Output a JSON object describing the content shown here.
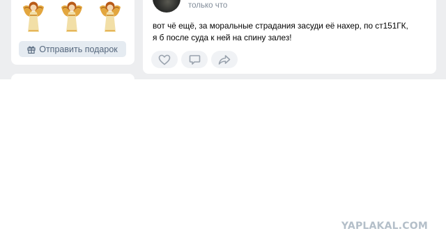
{
  "gifts": {
    "items": [
      {
        "icon": "angel-icon"
      },
      {
        "icon": "angel-icon"
      },
      {
        "icon": "angel-icon"
      }
    ],
    "send_button_label": "Отправить подарок"
  },
  "post": {
    "timestamp": "только что",
    "lines": [
      "вот чё ещё, за моральные страдания засуди её нахер, по ст151ГК,",
      "я б после суда к ней на спину залез!"
    ],
    "actions": [
      {
        "icon": "heart-icon"
      },
      {
        "icon": "comment-icon"
      },
      {
        "icon": "share-icon"
      }
    ]
  },
  "watermark": "YAPLAKAL.COM",
  "colors": {
    "page_background": "#edeef0",
    "card_background": "#ffffff",
    "button_background": "#e5ebf1",
    "button_text": "#55677d",
    "secondary_text": "#818c99",
    "action_background": "#f0f2f5",
    "icon_color": "#99a2ad",
    "watermark": "#b4bfc9"
  }
}
